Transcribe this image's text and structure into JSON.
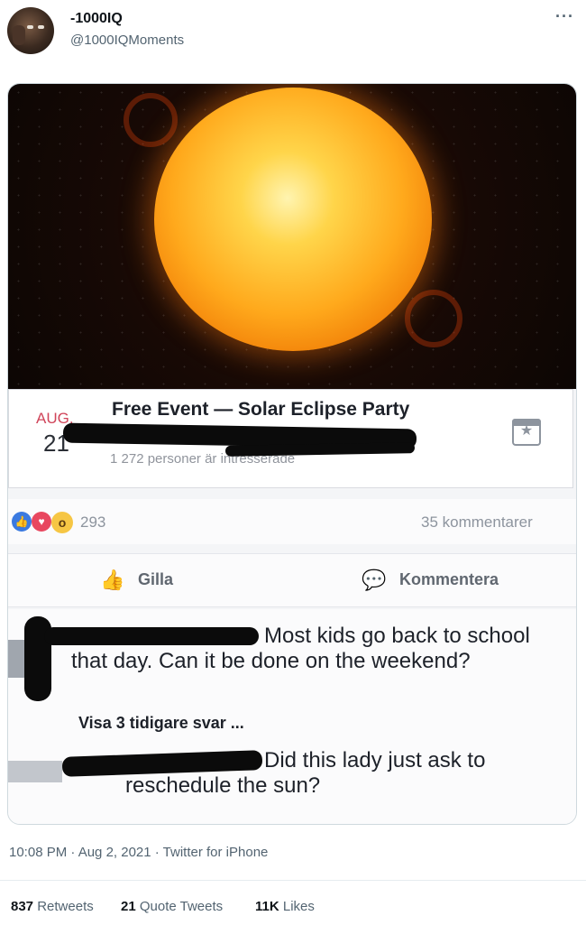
{
  "tweet": {
    "display_name": "-1000IQ",
    "handle": "@1000IQMoments",
    "more_icon": "more-horizontal-icon",
    "timestamp": "10:08 PM · Aug 2, 2021 · Twitter for iPhone",
    "stats": {
      "retweets_count": "837",
      "retweets_label": "Retweets",
      "quote_count": "21",
      "quote_label": "Quote Tweets",
      "likes_count": "11K",
      "likes_label": "Likes"
    }
  },
  "event": {
    "month": "AUG.",
    "day": "21",
    "title": "Free Event — Solar Eclipse Party",
    "interested": "1 272 personer är intresserade",
    "calendar_icon": "calendar-star-icon"
  },
  "reactions": {
    "count": "293",
    "comments": "35 kommentarer",
    "icons": [
      "like-reaction-icon",
      "love-reaction-icon",
      "wow-reaction-icon"
    ]
  },
  "actions": {
    "like_label": "Gilla",
    "comment_label": "Kommentera"
  },
  "comments": {
    "first_line1": "Most kids go back to school",
    "first_line2": "that day. Can it be done on the weekend?",
    "view_replies": "Visa 3 tidigare svar ...",
    "reply_line1": "Did this lady just ask to",
    "reply_line2": "reschedule the sun?"
  }
}
